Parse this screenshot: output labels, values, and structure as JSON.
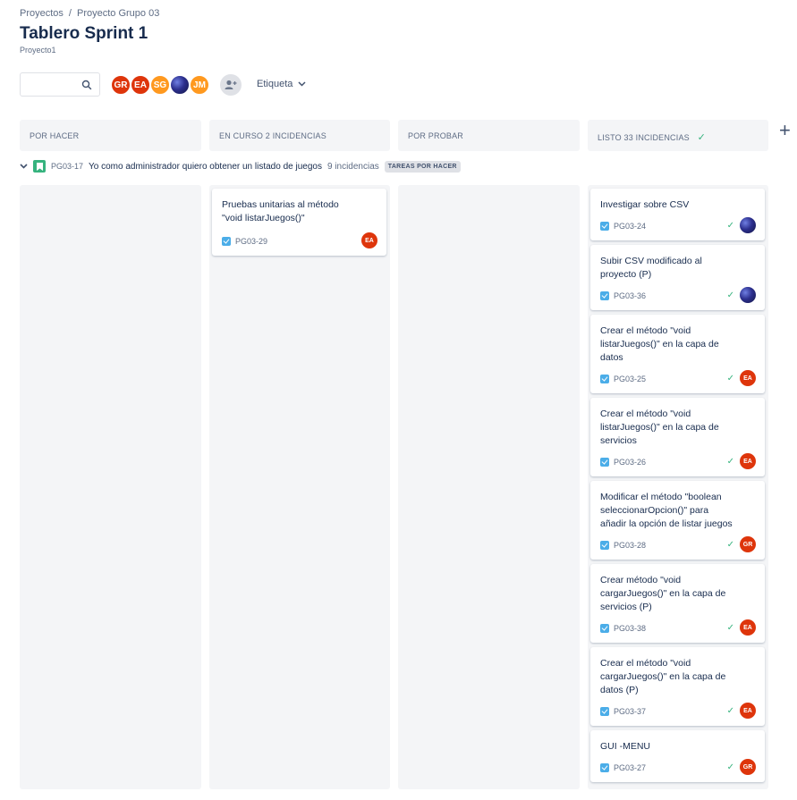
{
  "breadcrumb": {
    "item1": "Proyectos",
    "sep": "/",
    "item2": "Proyecto Grupo 03"
  },
  "title": "Tablero Sprint 1",
  "subtitle": "Proyecto1",
  "search": {
    "placeholder": "",
    "icon": "search-icon"
  },
  "avatars": [
    {
      "initials": "GR",
      "color": "#de350b"
    },
    {
      "initials": "EA",
      "color": "#de350b"
    },
    {
      "initials": "SG",
      "color": "#ff991f"
    },
    {
      "initials": "",
      "color": "#2c2f8e",
      "image": true
    },
    {
      "initials": "JM",
      "color": "#ff991f"
    }
  ],
  "filter": {
    "label": "Etiqueta"
  },
  "columns": [
    {
      "title": "POR HACER"
    },
    {
      "title": "EN CURSO 2 INCIDENCIAS"
    },
    {
      "title": "POR PROBAR"
    },
    {
      "title": "LISTO 33 INCIDENCIAS"
    }
  ],
  "swimlane": {
    "key": "PG03-17",
    "summary": "Yo como administrador quiero obtener un listado de juegos",
    "count": "9 incidencias",
    "badge": "TAREAS POR HACER"
  },
  "cards": {
    "in_progress": [
      {
        "summary": "Pruebas unitarias al método \"void listarJuegos()\"",
        "key": "PG03-29",
        "assignee": "EA"
      }
    ],
    "done": [
      {
        "summary": "Investigar sobre CSV",
        "key": "PG03-24",
        "assignee": ""
      },
      {
        "summary": "Subir CSV modificado al proyecto (P)",
        "key": "PG03-36",
        "assignee": ""
      },
      {
        "summary": "Crear el método \"void listarJuegos()\" en la capa de datos",
        "key": "PG03-25",
        "assignee": "EA"
      },
      {
        "summary": "Crear el método \"void listarJuegos()\" en la capa de servicios",
        "key": "PG03-26",
        "assignee": "EA"
      },
      {
        "summary": "Modificar el método \"boolean seleccionarOpcion()\" para añadir la opción de listar juegos",
        "key": "PG03-28",
        "assignee": "GR"
      },
      {
        "summary": "Crear método \"void cargarJuegos()\" en la capa de servicios (P)",
        "key": "PG03-38",
        "assignee": "EA"
      },
      {
        "summary": "Crear el método \"void cargarJuegos()\" en la capa de datos (P)",
        "key": "PG03-37",
        "assignee": "EA"
      },
      {
        "summary": "GUI -MENU",
        "key": "PG03-27",
        "assignee": "GR"
      }
    ]
  },
  "colors": {
    "accent_red": "#de350b",
    "accent_orange": "#ff991f",
    "done_green": "#36b37e",
    "task_blue": "#4bade8"
  }
}
